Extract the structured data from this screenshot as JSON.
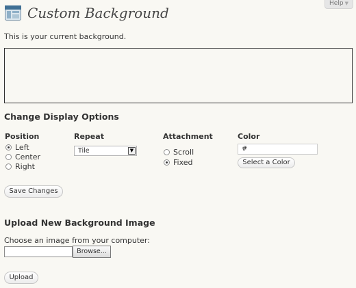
{
  "help_tab": {
    "label": "Help",
    "icon": "chevron-down-icon"
  },
  "header": {
    "icon": "appearance-icon",
    "title": "Custom Background"
  },
  "intro_text": "This is your current background.",
  "display_options": {
    "heading": "Change Display Options",
    "position": {
      "label": "Position",
      "options": [
        {
          "label": "Left",
          "selected": true
        },
        {
          "label": "Center",
          "selected": false
        },
        {
          "label": "Right",
          "selected": false
        }
      ]
    },
    "repeat": {
      "label": "Repeat",
      "selected": "Tile"
    },
    "attachment": {
      "label": "Attachment",
      "options": [
        {
          "label": "Scroll",
          "selected": false
        },
        {
          "label": "Fixed",
          "selected": true
        }
      ]
    },
    "color": {
      "label": "Color",
      "value": "#",
      "select_button": "Select a Color"
    },
    "save_button": "Save Changes"
  },
  "upload": {
    "heading": "Upload New Background Image",
    "prompt": "Choose an image from your computer:",
    "browse_button": "Browse...",
    "upload_button": "Upload"
  }
}
